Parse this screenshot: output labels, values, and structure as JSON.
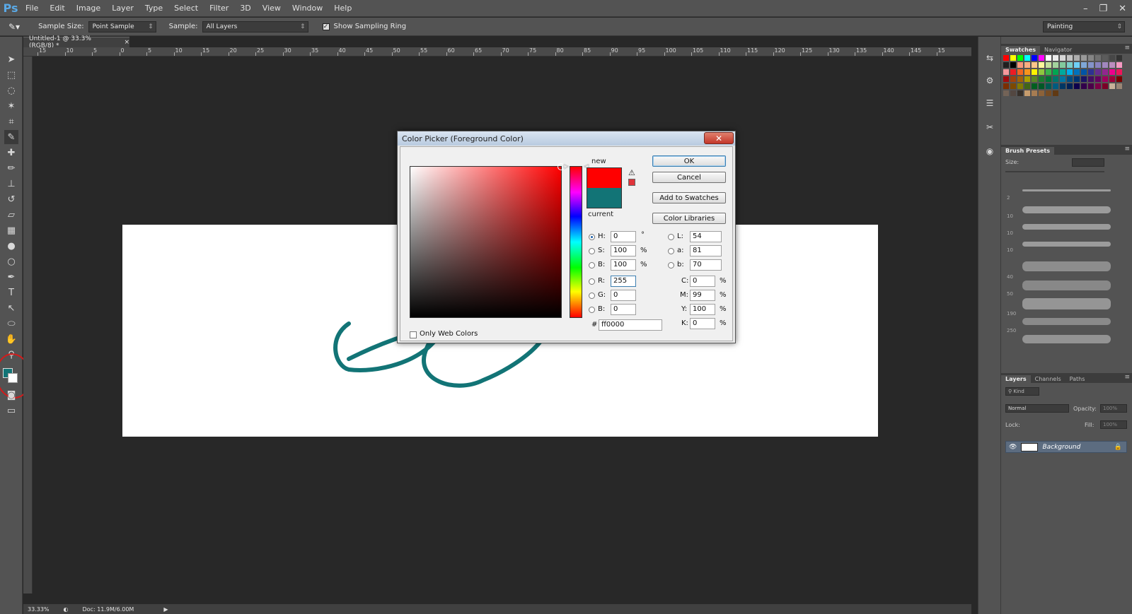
{
  "app": {
    "logo": "Ps"
  },
  "menu": [
    "File",
    "Edit",
    "Image",
    "Layer",
    "Type",
    "Select",
    "Filter",
    "3D",
    "View",
    "Window",
    "Help"
  ],
  "window_controls": {
    "minimize": "–",
    "restore": "❐",
    "close": "✕"
  },
  "options_bar": {
    "sample_size_label": "Sample Size:",
    "sample_size_value": "Point Sample",
    "sample_label": "Sample:",
    "sample_value": "All Layers",
    "show_ring_label": "Show Sampling Ring",
    "show_ring_checked": true,
    "workspace": "Painting"
  },
  "document": {
    "tab_title": "Untitled-1 @ 33.3% (RGB/8) *",
    "tab_close": "×",
    "ruler_labels": [
      "15",
      "10",
      "5",
      "0",
      "5",
      "10",
      "15",
      "20",
      "25",
      "30",
      "35",
      "40",
      "45",
      "50",
      "55",
      "60",
      "65",
      "70",
      "75",
      "80",
      "85",
      "90",
      "95",
      "100",
      "105",
      "110",
      "115",
      "120",
      "125",
      "130",
      "135",
      "140",
      "145",
      "15"
    ]
  },
  "status_bar": {
    "zoom": "33.33%",
    "doc_size": "Doc: 11.9M/6.00M"
  },
  "colors": {
    "foreground": "#127476",
    "background": "#ffffff",
    "new": "#ff0000",
    "current": "#127476",
    "stroke": "#127476",
    "highlight_circle": "#d21b1b"
  },
  "color_picker": {
    "title": "Color Picker (Foreground Color)",
    "close": "✕",
    "new_label": "new",
    "current_label": "current",
    "buttons": {
      "ok": "OK",
      "cancel": "Cancel",
      "add_to_swatches": "Add to Swatches",
      "color_libraries": "Color Libraries"
    },
    "hsb": {
      "h_label": "H:",
      "h": "0",
      "h_unit": "°",
      "s_label": "S:",
      "s": "100",
      "s_unit": "%",
      "b_label": "B:",
      "b": "100",
      "b_unit": "%"
    },
    "rgb": {
      "r_label": "R:",
      "r": "255",
      "g_label": "G:",
      "g": "0",
      "b_label": "B:",
      "b": "0"
    },
    "lab": {
      "l_label": "L:",
      "l": "54",
      "a_label": "a:",
      "a": "81",
      "b_label": "b:",
      "b": "70"
    },
    "cmyk": {
      "c_label": "C:",
      "c": "0",
      "m_label": "M:",
      "m": "99",
      "y_label": "Y:",
      "y": "100",
      "k_label": "K:",
      "k": "0",
      "unit": "%"
    },
    "hex_label": "#",
    "hex": "ff0000",
    "only_web_colors_label": "Only Web Colors",
    "selected_mode": "H"
  },
  "panels": {
    "swatches_tabs": [
      "Swatches",
      "Navigator"
    ],
    "brush_presets": {
      "title": "Brush Presets",
      "size_label": "Size:",
      "brush_sizes": [
        "2",
        "10",
        "10",
        "10",
        "40",
        "50",
        "190",
        "250"
      ]
    },
    "layers_tabs": [
      "Layers",
      "Channels",
      "Paths"
    ],
    "kind_label": "Kind",
    "blend_mode": "Normal",
    "opacity_label": "Opacity:",
    "opacity_value": "100%",
    "lock_label": "Lock:",
    "fill_label": "Fill:",
    "fill_value": "100%",
    "layer_name": "Background"
  }
}
